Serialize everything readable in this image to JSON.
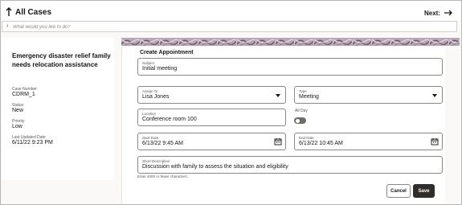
{
  "header": {
    "title": "All Cases",
    "next_label": "Next:"
  },
  "ask_bar": {
    "placeholder": "What would you like to do?"
  },
  "case": {
    "title": "Emergency disaster relief family needs relocation assistance",
    "fields": [
      {
        "label": "Case Number",
        "value": "CDRM_1"
      },
      {
        "label": "Status",
        "value": "New"
      },
      {
        "label": "Priority",
        "value": "Low"
      },
      {
        "label": "Last Updated Date",
        "value": "6/11/22 9:23 PM"
      }
    ]
  },
  "form": {
    "title": "Create Appointment",
    "subject": {
      "label": "Subject",
      "value": "Initial meeting"
    },
    "assign_to": {
      "label": "Assign To",
      "value": "Lisa Jones"
    },
    "type": {
      "label": "Type",
      "value": "Meeting"
    },
    "location": {
      "label": "Location",
      "value": "Conference room 100"
    },
    "all_day": {
      "label": "All Day",
      "on": false
    },
    "start_date": {
      "label": "Start Date",
      "value": "6/13/22 9:45 AM"
    },
    "end_date": {
      "label": "End Date",
      "value": "6/13/22 10:45 AM"
    },
    "description": {
      "label": "Short Description",
      "value": "Discussion with family to assess the situation and eligibility"
    },
    "hint": "Enter 4000 or fewer characters.",
    "cancel_label": "Cancel",
    "save_label": "Save"
  }
}
